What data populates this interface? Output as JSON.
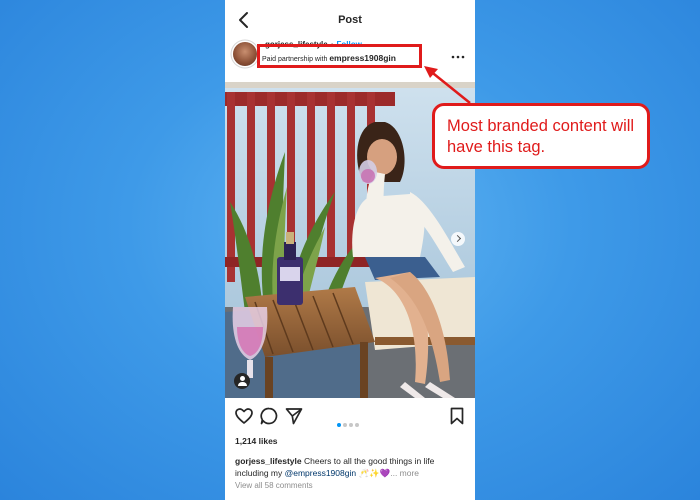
{
  "topbar": {
    "title": "Post",
    "back_icon": "chevron-left-icon"
  },
  "post_header": {
    "username": "gorjess_lifestyle",
    "separator": "•",
    "follow_label": "Follow",
    "partnership_prefix": "Paid partnership with ",
    "partner_brand": "empress1908gin",
    "more_icon": "more-horizontal-icon"
  },
  "annotation": {
    "callout_text": "Most branded content will have this tag.",
    "highlight_color": "#e01b1b"
  },
  "actions": {
    "like_icon": "heart-icon",
    "comment_icon": "comment-icon",
    "share_icon": "send-icon",
    "save_icon": "bookmark-icon",
    "carousel_count": 4,
    "carousel_active": 1
  },
  "likes": "1,214 likes",
  "caption": {
    "username": "gorjess_lifestyle",
    "text_before": " Cheers to all the good things in life including my ",
    "mention": "@empress1908gin",
    "emoji": " 🥂✨💜",
    "more_label": "... more"
  },
  "comments_link": "View all 58 comments",
  "colors": {
    "accent_blue": "#0095f6",
    "annotation_red": "#e01b1b",
    "background_blue": "#3e9ae8"
  }
}
